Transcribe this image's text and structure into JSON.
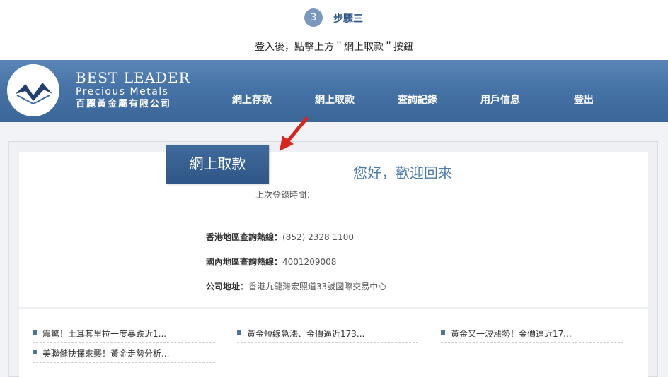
{
  "step": {
    "number": "3",
    "title": "步驟三"
  },
  "instruction": "登入後，點擊上方＂網上取款＂按鈕",
  "brand": {
    "name_en_1": "BEST LEADER",
    "name_en_2": "Precious Metals",
    "name_zh": "百麗黃金屬有限公司"
  },
  "nav": {
    "items": [
      {
        "label": "網上存款"
      },
      {
        "label": "網上取款"
      },
      {
        "label": "查詢記錄"
      },
      {
        "label": "用戶信息"
      },
      {
        "label": "登出"
      }
    ]
  },
  "main": {
    "withdraw_button": "網上取款",
    "welcome": "您好，歡迎回來",
    "last_login_label": "上次登錄時間："
  },
  "contact": {
    "hk_label": "香港地區查詢熱線：",
    "hk_value": "(852) 2328 1100",
    "cn_label": "國內地區查詢熱線：",
    "cn_value": "4001209008",
    "addr_label": "公司地址：",
    "addr_value": "香港九龍灣宏照道33號國際交易中心"
  },
  "news": [
    {
      "title": "震驚！土耳其里拉一度暴跌近1..."
    },
    {
      "title": "黃金短線急漲、金價逼近173..."
    },
    {
      "title": "黃金又一波漲勢！金價逼近17..."
    },
    {
      "title": "美聯儲抉擇來襲！黃金走勢分析..."
    }
  ],
  "colors": {
    "banner": "#4673a6",
    "accent": "#2c5587",
    "arrow": "#d9261c"
  }
}
